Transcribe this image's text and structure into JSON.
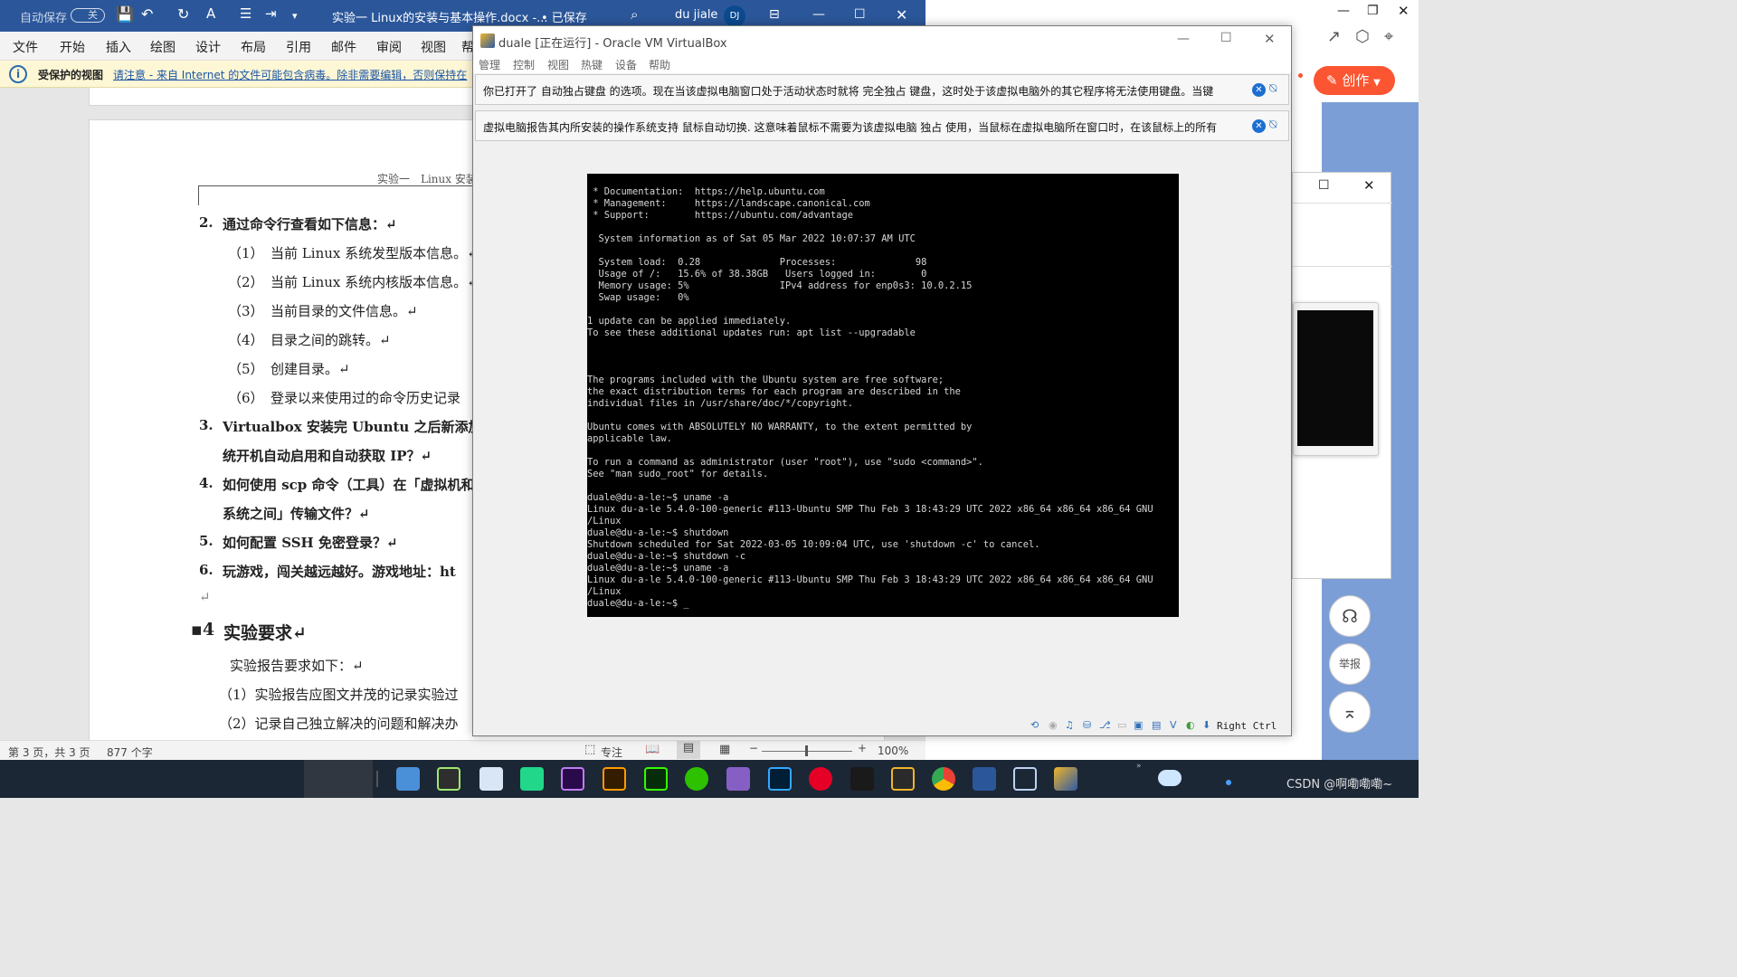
{
  "word": {
    "autosave_label": "自动保存",
    "autosave_state": "关",
    "doc_title": "实验一 Linux的安装与基本操作.docx -...",
    "saved_label": "• 已保存",
    "user_name": "du jiale",
    "user_initials": "DJ",
    "ribbon_tabs": [
      "文件",
      "开始",
      "插入",
      "绘图",
      "设计",
      "布局",
      "引用",
      "邮件",
      "审阅",
      "视图",
      "帮"
    ],
    "protected_label": "受保护的视图",
    "protected_message": "请注意 - 来自 Internet 的文件可能包含病毒。除非需要编辑，否则保持在",
    "header_text": "实验一　Linux 安装",
    "lines": {
      "q2": "通过命令行查看如下信息：↵",
      "s1": "（1）　当前 Linux 系统发型版本信息。↵",
      "s2": "（2）　当前 Linux 系统内核版本信息。↵",
      "s3": "（3）　当前目录的文件信息。↵",
      "s4": "（4）　目录之间的跳转。↵",
      "s5": "（5）　创建目录。↵",
      "s6": "（6）　登录以来使用过的命令历史记录",
      "q3a": "Virtualbox 安装完 Ubuntu 之后新添加",
      "q3b": "统开机自动启用和自动获取 IP？↵",
      "q4a": "如何使用 scp 命令（工具）在「虚拟机和",
      "q4b": "系统之间」传输文件？↵",
      "q5": "如何配置 SSH 免密登录？↵",
      "q6": "玩游戏，闯关越远越好。游戏地址：ht",
      "empty": "↵",
      "h4": "实验要求↵",
      "req": "实验报告要求如下：↵",
      "r1": "（1）实验报告应图文并茂的记录实验过",
      "r2": "（2）记录自己独立解决的问题和解决办"
    },
    "nums": {
      "q2": "2.",
      "q3": "3.",
      "q4": "4.",
      "q5": "5.",
      "q6": "6.",
      "h4": "▪4"
    },
    "status_page": "第 3 页，共 3 页",
    "status_words": "877 个字",
    "status_focus": "专注",
    "zoom": "100%"
  },
  "vbox": {
    "title": "duale [正在运行] - Oracle VM VirtualBox",
    "menu": [
      "管理",
      "控制",
      "视图",
      "热键",
      "设备",
      "帮助"
    ],
    "notice1": "你已打开了 自动独占键盘 的选项。现在当该虚拟电脑窗口处于活动状态时就将 完全独占 键盘，这时处于该虚拟电脑外的其它程序将无法使用键盘。当键",
    "notice2": "虚拟电脑报告其内所安装的操作系统支持 鼠标自动切换. 这意味着鼠标不需要为该虚拟电脑 独占 使用，当鼠标在虚拟电脑所在窗口时，在该鼠标上的所有",
    "host_key": "Right Ctrl",
    "terminal_lines": [
      " * Documentation:  https://help.ubuntu.com",
      " * Management:     https://landscape.canonical.com",
      " * Support:        https://ubuntu.com/advantage",
      "",
      "  System information as of Sat 05 Mar 2022 10:07:37 AM UTC",
      "",
      "  System load:  0.28              Processes:              98",
      "  Usage of /:   15.6% of 38.38GB   Users logged in:        0",
      "  Memory usage: 5%                IPv4 address for enp0s3: 10.0.2.15",
      "  Swap usage:   0%",
      "",
      "1 update can be applied immediately.",
      "To see these additional updates run: apt list --upgradable",
      "",
      "",
      "",
      "The programs included with the Ubuntu system are free software;",
      "the exact distribution terms for each program are described in the",
      "individual files in /usr/share/doc/*/copyright.",
      "",
      "Ubuntu comes with ABSOLUTELY NO WARRANTY, to the extent permitted by",
      "applicable law.",
      "",
      "To run a command as administrator (user \"root\"), use \"sudo <command>\".",
      "See \"man sudo_root\" for details.",
      "",
      "duale@du-a-le:~$ uname -a",
      "Linux du-a-le 5.4.0-100-generic #113-Ubuntu SMP Thu Feb 3 18:43:29 UTC 2022 x86_64 x86_64 x86_64 GNU",
      "/Linux",
      "duale@du-a-le:~$ shutdown",
      "Shutdown scheduled for Sat 2022-03-05 10:09:04 UTC, use 'shutdown -c' to cancel.",
      "duale@du-a-le:~$ shutdown -c",
      "duale@du-a-le:~$ uname -a",
      "Linux du-a-le 5.4.0-100-generic #113-Ubuntu SMP Thu Feb 3 18:43:29 UTC 2022 x86_64 x86_64 x86_64 GNU",
      "/Linux",
      "duale@du-a-le:~$ _"
    ]
  },
  "browser": {
    "create_label": "创作",
    "report_label": "举报",
    "watermark": "CSDN @啊嘞嘞嘞~"
  },
  "colors": {
    "word_blue": "#2b579a",
    "csdn_red": "#fc5531",
    "taskbar": "#1c2736"
  }
}
